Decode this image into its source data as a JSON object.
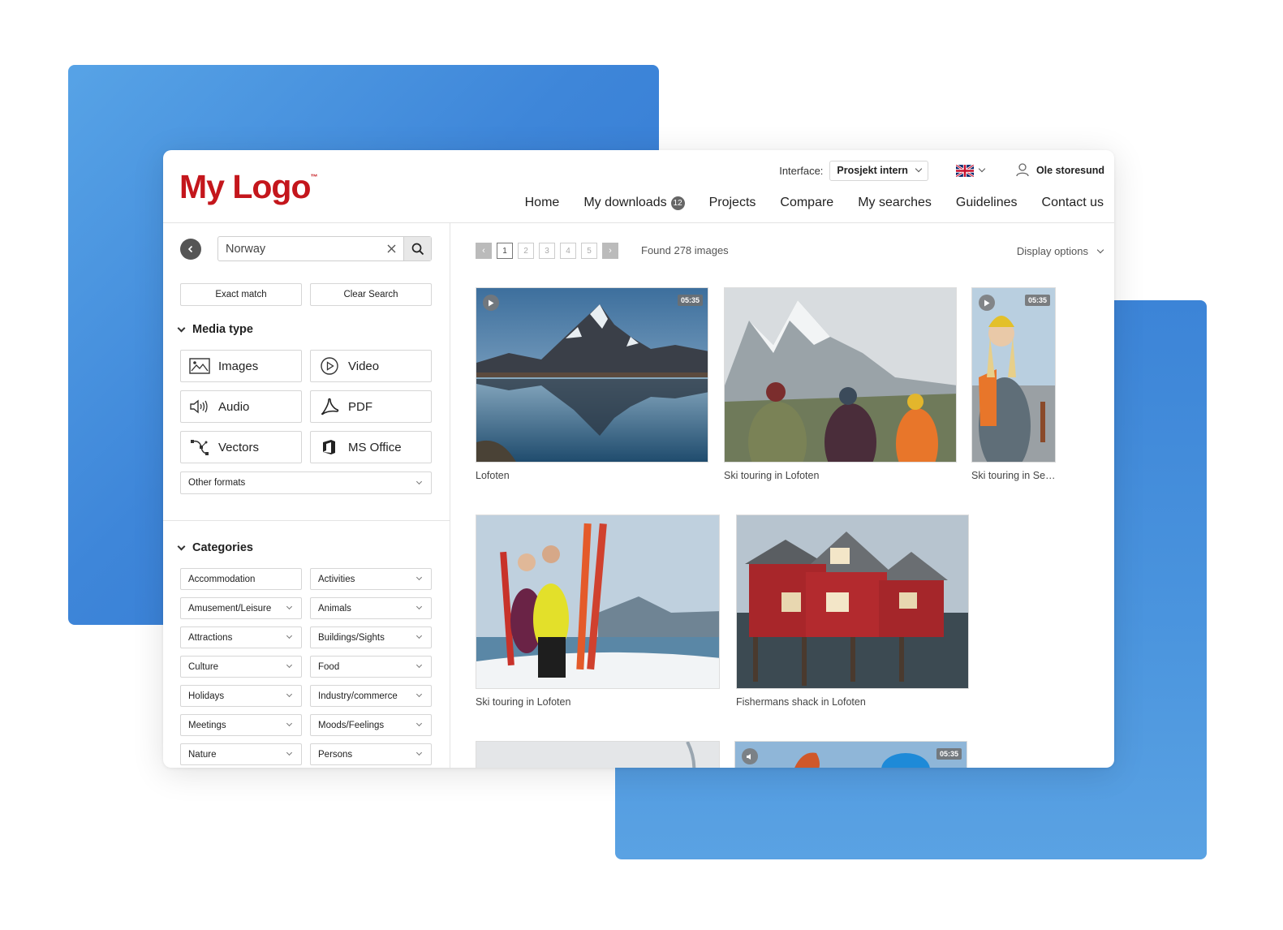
{
  "header": {
    "logo_text": "My Logo",
    "logo_tm": "™",
    "interface_label": "Interface:",
    "interface_value": "Prosjekt intern",
    "language_flag": "uk-flag-icon",
    "user_name": "Ole storesund"
  },
  "nav": {
    "home": "Home",
    "downloads": "My downloads",
    "downloads_count": "12",
    "projects": "Projects",
    "compare": "Compare",
    "searches": "My searches",
    "guidelines": "Guidelines",
    "contact": "Contact us"
  },
  "search": {
    "value": "Norway",
    "clear_icon": "close-icon",
    "submit_icon": "search-icon"
  },
  "buttons": {
    "exact_match": "Exact match",
    "clear_search": "Clear Search"
  },
  "media_type": {
    "title": "Media type",
    "items": [
      {
        "label": "Images",
        "icon": "image-icon"
      },
      {
        "label": "Video",
        "icon": "play-circle-icon"
      },
      {
        "label": "Audio",
        "icon": "speaker-icon"
      },
      {
        "label": "PDF",
        "icon": "pdf-icon"
      },
      {
        "label": "Vectors",
        "icon": "vector-icon"
      },
      {
        "label": "MS Office",
        "icon": "office-icon"
      }
    ],
    "other_formats": "Other formats"
  },
  "categories": {
    "title": "Categories",
    "items": [
      {
        "label": "Accommodation",
        "expandable": false
      },
      {
        "label": "Activities",
        "expandable": true
      },
      {
        "label": "Amusement/Leisure",
        "expandable": true
      },
      {
        "label": "Animals",
        "expandable": true
      },
      {
        "label": "Attractions",
        "expandable": true
      },
      {
        "label": "Buildings/Sights",
        "expandable": true
      },
      {
        "label": "Culture",
        "expandable": true
      },
      {
        "label": "Food",
        "expandable": true
      },
      {
        "label": "Holidays",
        "expandable": true
      },
      {
        "label": "Industry/commerce",
        "expandable": true
      },
      {
        "label": "Meetings",
        "expandable": true
      },
      {
        "label": "Moods/Feelings",
        "expandable": true
      },
      {
        "label": "Nature",
        "expandable": true
      },
      {
        "label": "Persons",
        "expandable": true
      }
    ]
  },
  "results": {
    "pages": [
      "1",
      "2",
      "3",
      "4",
      "5"
    ],
    "active_page": "1",
    "found_text": "Found 278 images",
    "display_options": "Display options",
    "items": [
      {
        "caption": "Lofoten",
        "type": "video",
        "duration": "05:35"
      },
      {
        "caption": "Ski touring in Lofoten",
        "type": "image"
      },
      {
        "caption": "Ski touring in Se…",
        "type": "video",
        "duration": "05:35"
      },
      {
        "caption": "Ski touring in Lofoten",
        "type": "image"
      },
      {
        "caption": "Fishermans shack in Lofoten",
        "type": "image"
      },
      {
        "caption": "",
        "type": "image"
      },
      {
        "caption": "",
        "type": "audio",
        "duration": "05:35"
      }
    ]
  },
  "colors": {
    "brand": "#c4161c",
    "bg_blue": "#3e86d9"
  }
}
